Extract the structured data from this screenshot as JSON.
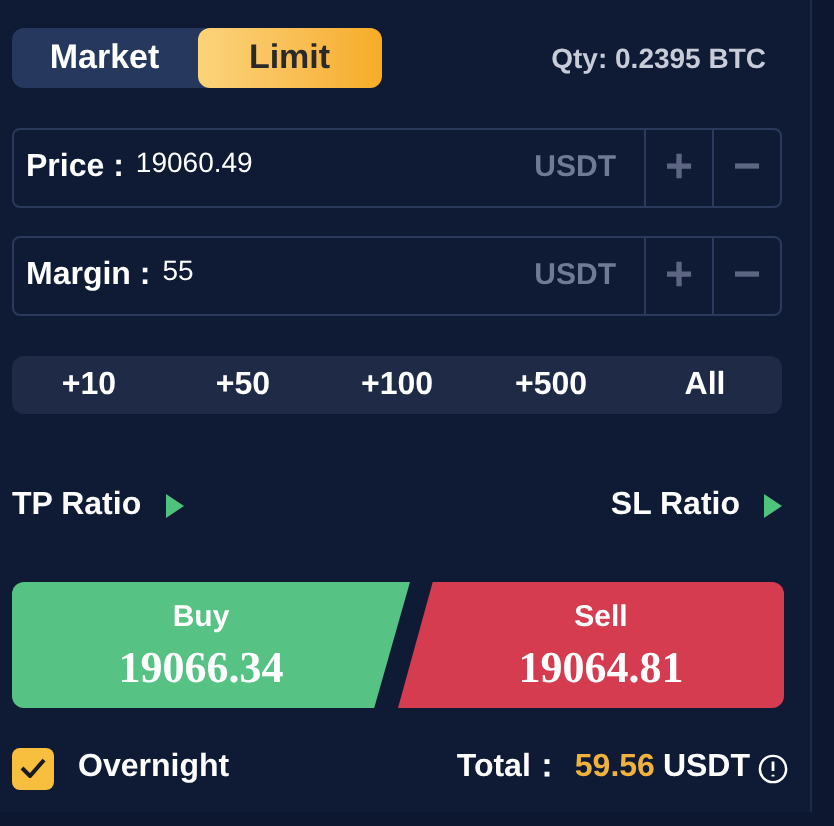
{
  "order_tabs": [
    {
      "label": "Market",
      "selected": false
    },
    {
      "label": "Limit",
      "selected": true
    }
  ],
  "qty": "Qty: 0.2395 BTC",
  "fields": [
    {
      "label": "Price :",
      "value": "19060.49",
      "unit": "USDT",
      "plus": "+",
      "minus": "−"
    },
    {
      "label": "Margin :",
      "value": "55",
      "unit": "USDT",
      "plus": "+",
      "minus": "−"
    }
  ],
  "quick_amounts": [
    "+10",
    "+50",
    "+100",
    "+500",
    "All"
  ],
  "ratios": [
    {
      "label": "TP Ratio"
    },
    {
      "label": "SL Ratio"
    }
  ],
  "buy": {
    "label": "Buy",
    "price": "19066.34"
  },
  "sell": {
    "label": "Sell",
    "price": "19064.81"
  },
  "overnight": {
    "label": "Overnight",
    "checked": true
  },
  "total": {
    "label": "Total：",
    "amount": "59.56",
    "unit": "USDT"
  }
}
